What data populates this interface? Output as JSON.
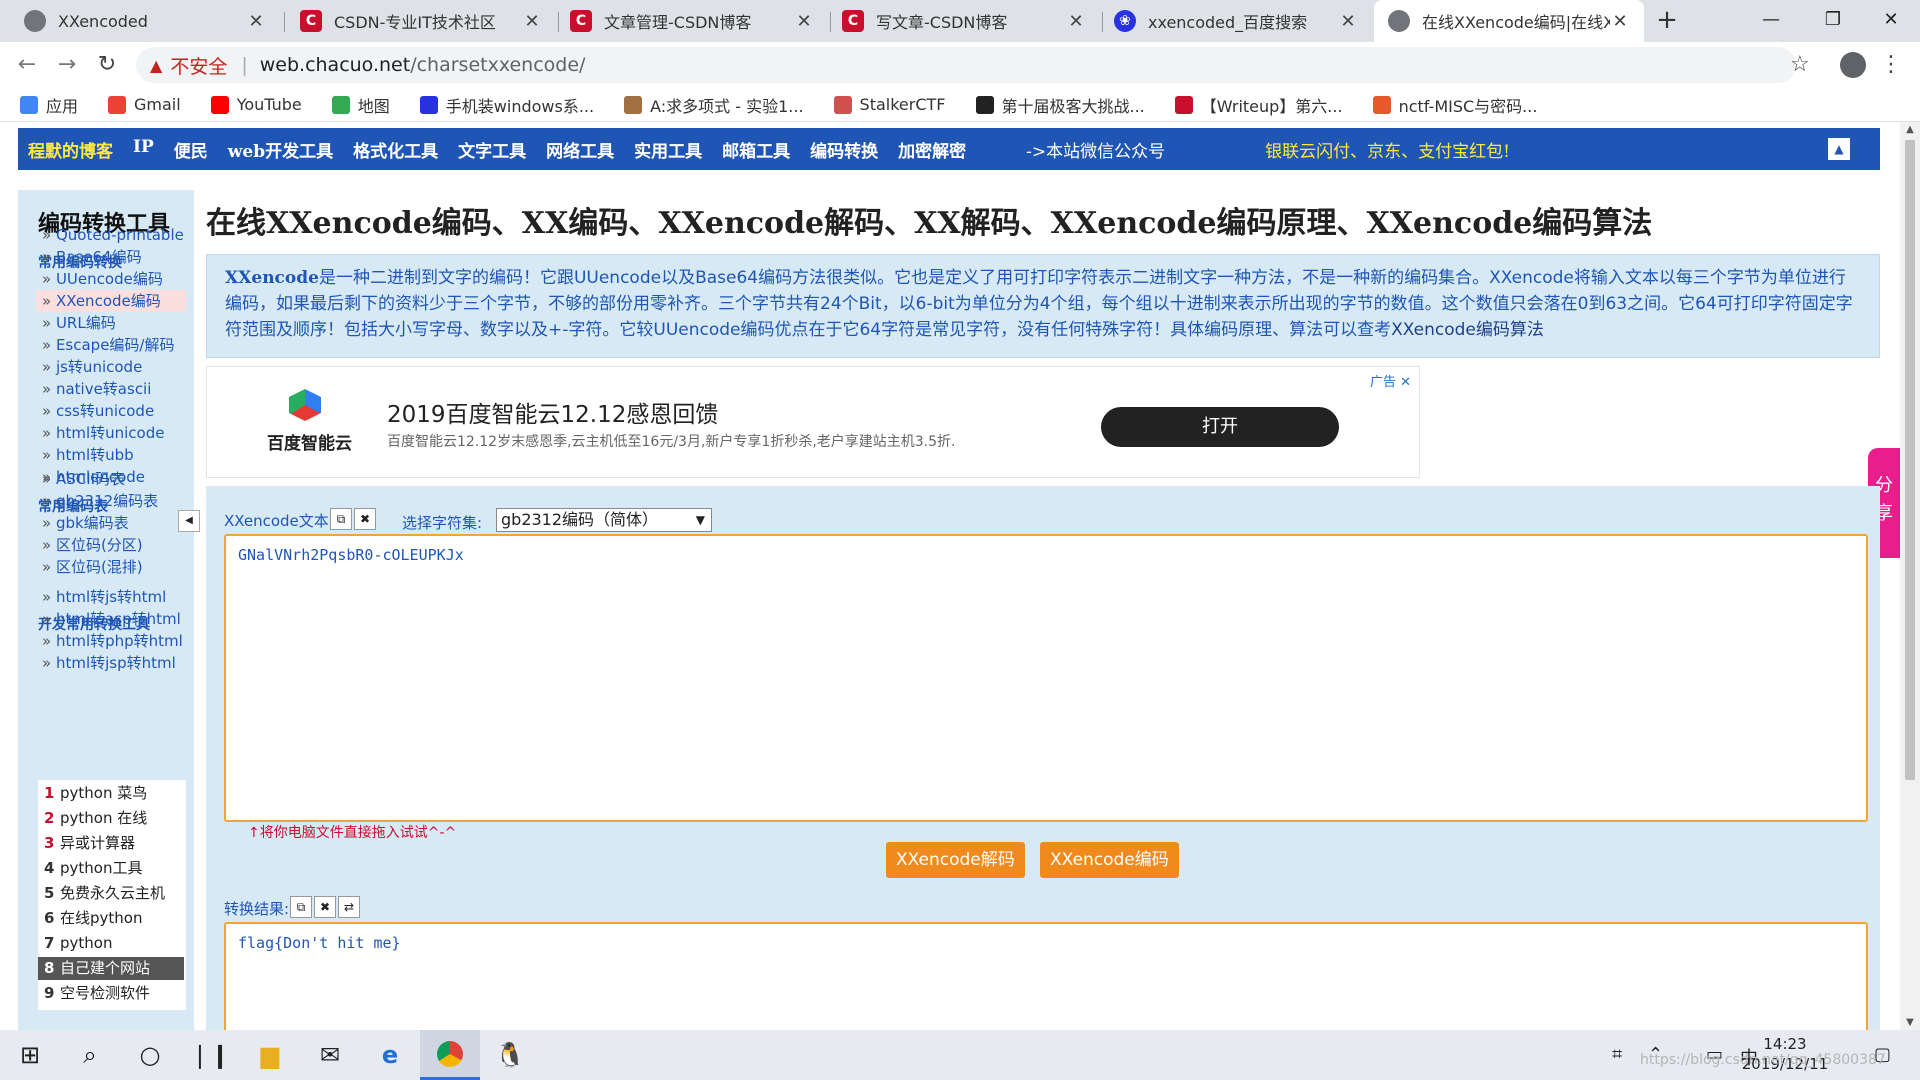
{
  "tabs": [
    {
      "title": "XXencoded",
      "favicon": "globe-icon"
    },
    {
      "title": "CSDN-专业IT技术社区",
      "favicon": "csdn-icon"
    },
    {
      "title": "文章管理-CSDN博客",
      "favicon": "csdn-icon"
    },
    {
      "title": "写文章-CSDN博客",
      "favicon": "csdn-icon"
    },
    {
      "title": "xxencoded_百度搜索",
      "favicon": "baidu-paw-icon"
    },
    {
      "title": "在线XXencode编码|在线XX",
      "favicon": "globe-icon"
    }
  ],
  "address": {
    "security": "不安全",
    "host": "web.chacuo.net",
    "path": "/charsetxxencode/"
  },
  "bookmarks": [
    {
      "label": "应用",
      "color": "#4285f4"
    },
    {
      "label": "Gmail",
      "color": "#ea4335"
    },
    {
      "label": "YouTube",
      "color": "#ff0000"
    },
    {
      "label": "地图",
      "color": "#34a853"
    },
    {
      "label": "手机装windows系...",
      "color": "#2932e1"
    },
    {
      "label": "A:求多项式 - 实验1...",
      "color": "#a07040"
    },
    {
      "label": "StalkerCTF",
      "color": "#d05050"
    },
    {
      "label": "第十届极客大挑战...",
      "color": "#222222"
    },
    {
      "label": "【Writeup】第六...",
      "color": "#c8102e"
    },
    {
      "label": "nctf-MISC与密码...",
      "color": "#e65a2c"
    }
  ],
  "topnav": {
    "brand": "程默的博客",
    "items": [
      "IP",
      "便民",
      "web开发工具",
      "格式化工具",
      "文字工具",
      "网络工具",
      "实用工具",
      "邮箱工具",
      "编码转换",
      "加密解密"
    ],
    "wechat": "->本站微信公众号",
    "promo": "银联云闪付、京东、支付宝红包!"
  },
  "sidebar": {
    "title": "编码转换工具",
    "section1": "常用编码转换",
    "links1": [
      "Quoted-printable",
      "Base64编码",
      "UUencode编码",
      "XXencode编码",
      "URL编码",
      "Escape编码/解码",
      "js转unicode",
      "native转ascii",
      "css转unicode",
      "html转unicode",
      "html转ubb",
      "htmlencode"
    ],
    "section2": "常用编码表",
    "links2": [
      "ASCII码表",
      "gb2312编码表",
      "gbk编码表",
      "区位码(分区)",
      "区位码(混排)"
    ],
    "section3": "开发常用转换工具",
    "links3": [
      "html转js转html",
      "html转asp转html",
      "html转php转html",
      "html转jsp转html"
    ],
    "ranks": [
      {
        "n": "1",
        "label": "python 菜鸟"
      },
      {
        "n": "2",
        "label": "python 在线"
      },
      {
        "n": "3",
        "label": "异或计算器"
      },
      {
        "n": "4",
        "label": "python工具"
      },
      {
        "n": "5",
        "label": "免费永久云主机"
      },
      {
        "n": "6",
        "label": "在线python"
      },
      {
        "n": "7",
        "label": "python"
      },
      {
        "n": "8",
        "label": "自己建个网站"
      },
      {
        "n": "9",
        "label": "空号检测软件"
      }
    ]
  },
  "main": {
    "title": "在线XXencode编码、XX编码、XXencode解码、XX解码、XXencode编码原理、XXencode编码算法",
    "intro_lead": "XXencode",
    "intro_body": "是一种二进制到文字的编码！它跟UUencode以及Base64编码方法很类似。它也是定义了用可打印字符表示二进制文字一种方法，不是一种新的编码集合。XXencode将输入文本以每三个字节为单位进行编码，如果最后剩下的资料少于三个字节，不够的部份用零补齐。三个字节共有24个Bit，以6-bit为单位分为4个组，每个组以十进制来表示所出现的字节的数值。这个数值只会落在0到63之间。它64可打印字符固定字符范围及顺序！包括大小写字母、数字以及+-字符。它较UUencode编码优点在于它64字符是常见字符，没有任何特殊字符！具体编码原理、算法可以查考",
    "intro_link": "XXencode编码算法",
    "ad": {
      "brand": "百度智能云",
      "headline": "2019百度智能云12.12感恩回馈",
      "desc": "百度智能云12.12岁末感恩季,云主机低至16元/3月,新户专享1折秒杀,老户享建站主机3.5折.",
      "button": "打开",
      "tag": "广告"
    },
    "share": "分享",
    "input_label": "XXencode文本:",
    "charset_label": "选择字符集:",
    "charset_value": "gb2312编码（简体）",
    "input_value": "GNalVNrh2PqsbR0-cOLEUPKJx",
    "hint": "↑将你电脑文件直接拖入试试^-^",
    "decode_button": "XXencode解码",
    "encode_button": "XXencode编码",
    "result_label": "转换结果:",
    "result_value": "flag{Don't hit me}"
  },
  "taskbar": {
    "time": "14:23",
    "date": "2019/12/11",
    "ime": "中",
    "watermark": "https://blog.csdn.net/qq_45800387"
  }
}
